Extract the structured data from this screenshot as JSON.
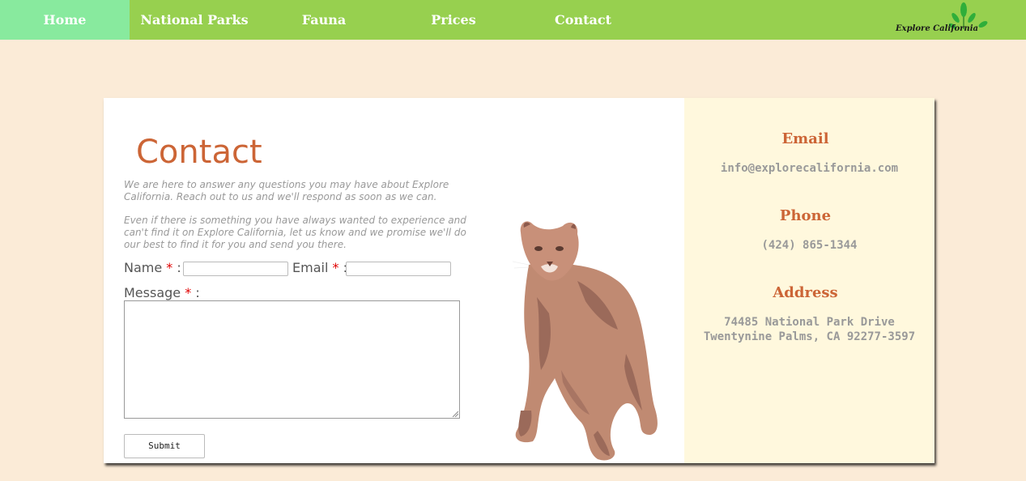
{
  "colors": {
    "nav_bg": "#97d04f",
    "nav_active": "#88ea9e",
    "page_bg": "#fbebd7",
    "accent": "#cc6536",
    "aside_bg": "#fff8dd",
    "required": "#e00000"
  },
  "nav": {
    "items": [
      {
        "label": "Home",
        "active": true
      },
      {
        "label": "National Parks"
      },
      {
        "label": "Fauna"
      },
      {
        "label": "Prices"
      },
      {
        "label": "Contact"
      }
    ],
    "logo_text": "Explore California",
    "logo_icon": "leaves-icon"
  },
  "main": {
    "title": "Contact",
    "intro": [
      "We are here to answer any questions you may have about Explore California. Reach out to us and we'll respond as soon as we can.",
      "Even if there is something you have always wanted to experience and can't find it on Explore California, let us know and we promise we'll do our best to find it for you and send you there."
    ]
  },
  "form": {
    "name_label": "Name",
    "email_label": "Email",
    "message_label": "Message",
    "required_mark": "*",
    "separator": ":",
    "name_value": "",
    "email_value": "",
    "message_value": "",
    "submit_label": "Submit"
  },
  "aside": {
    "email_heading": "Email",
    "email_value": "info@explorecalifornia.com",
    "phone_heading": "Phone",
    "phone_value": "(424) 865-1344",
    "address_heading": "Address",
    "address_line1": "74485 National Park Drive",
    "address_line2": "Twentynine Palms, CA 92277-3597"
  },
  "image": {
    "icon": "cougar-illustration"
  }
}
